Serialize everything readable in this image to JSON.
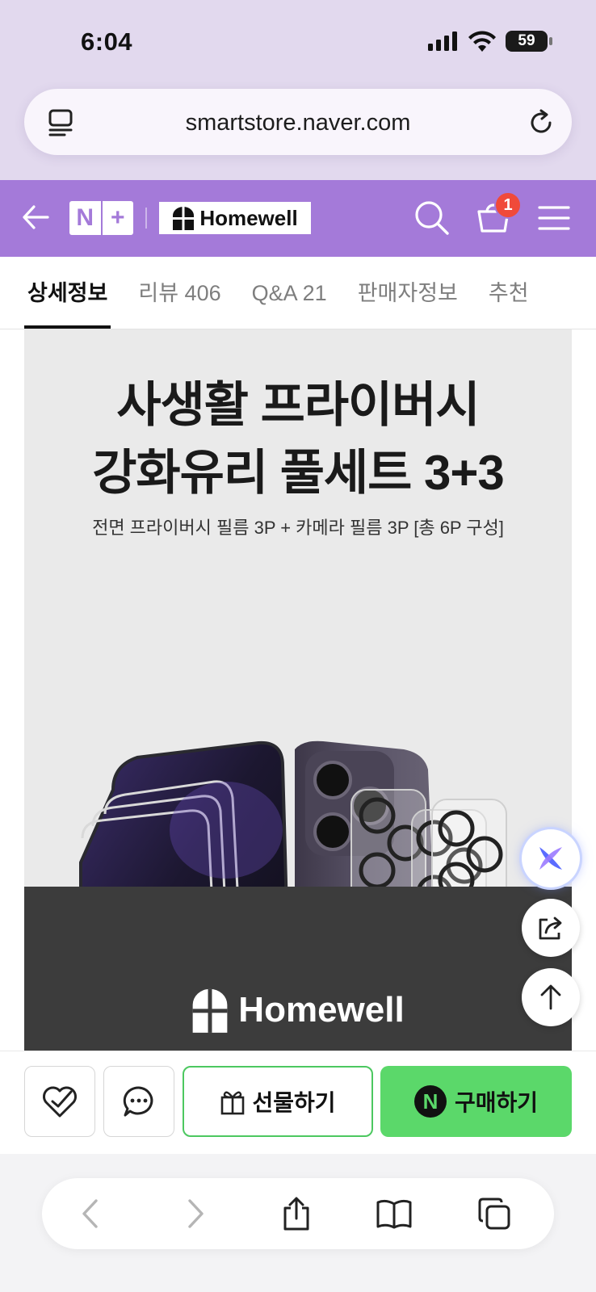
{
  "status_bar": {
    "time": "6:04",
    "battery": "59"
  },
  "browser": {
    "url": "smartstore.naver.com"
  },
  "store_header": {
    "nplus_left": "N",
    "nplus_right": "+",
    "brand": "Homewell",
    "cart_count": "1"
  },
  "tabs": [
    {
      "label": "상세정보",
      "active": true
    },
    {
      "label": "리뷰 406",
      "active": false
    },
    {
      "label": "Q&A 21",
      "active": false
    },
    {
      "label": "판매자정보",
      "active": false
    },
    {
      "label": "추천",
      "active": false
    }
  ],
  "banner": {
    "title_line1": "사생활 프라이버시",
    "title_line2": "강화유리 풀세트 3+3",
    "subtitle": "전면 프라이버시 필름 3P + 카메라 필름 3P [총 6P 구성]",
    "brand": "Homewell"
  },
  "actions": {
    "gift_label": "선물하기",
    "buy_label": "구매하기",
    "buy_badge": "N"
  },
  "colors": {
    "header_purple": "#a47ad9",
    "buy_green": "#5bd86a",
    "badge_red": "#f04a3a"
  },
  "icons": {
    "url_left": "reader-icon",
    "reload": "reload-icon",
    "back": "back-arrow-icon",
    "search": "search-icon",
    "cart": "cart-icon",
    "menu": "hamburger-menu-icon",
    "ai": "ai-assistant-icon",
    "share": "share-icon",
    "top": "scroll-top-icon",
    "wishlist": "heart-check-icon",
    "chat": "chat-bubble-icon",
    "gift": "gift-icon"
  }
}
